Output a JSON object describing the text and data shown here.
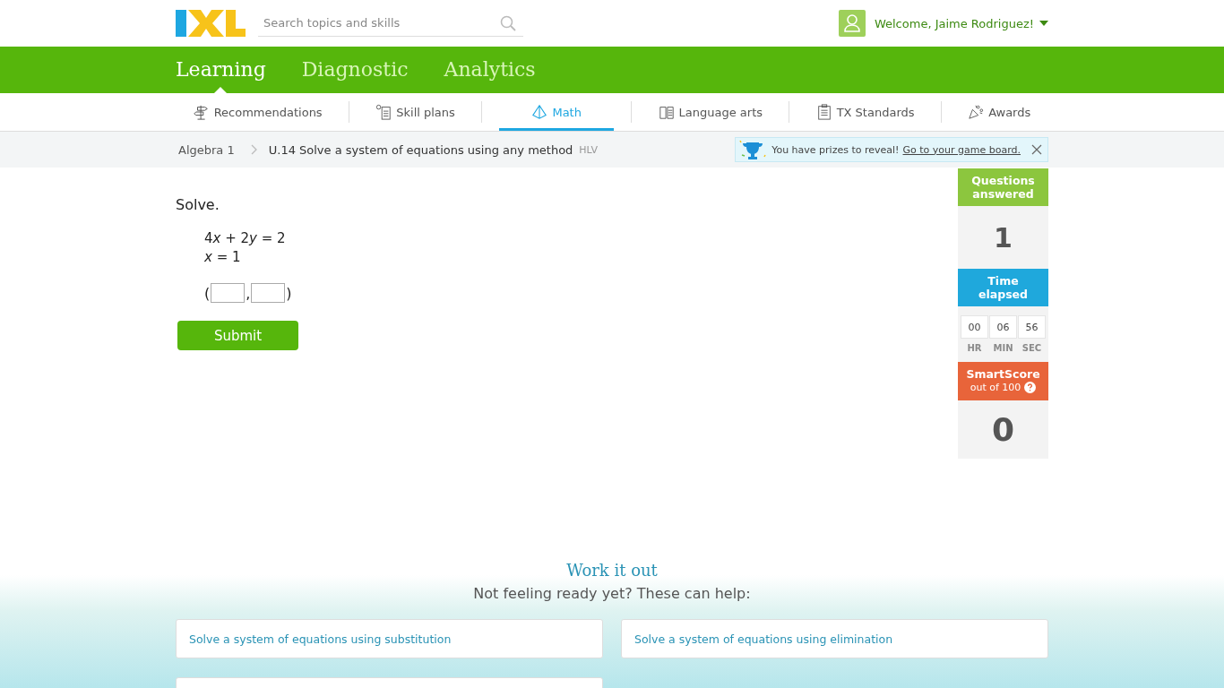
{
  "header": {
    "search": {
      "placeholder": "Search topics and skills"
    },
    "welcome": "Welcome, Jaime Rodriguez!"
  },
  "main_nav": [
    {
      "label": "Learning",
      "selected": true
    },
    {
      "label": "Diagnostic",
      "selected": false
    },
    {
      "label": "Analytics",
      "selected": false
    }
  ],
  "sub_nav": [
    {
      "label": "Recommendations",
      "kind": "recommend",
      "selected": false
    },
    {
      "label": "Skill plans",
      "kind": "plans",
      "selected": false
    },
    {
      "label": "Math",
      "kind": "math",
      "selected": true
    },
    {
      "label": "Language arts",
      "kind": "book",
      "selected": false
    },
    {
      "label": "TX Standards",
      "kind": "standards",
      "selected": false
    },
    {
      "label": "Awards",
      "kind": "awards",
      "selected": false
    }
  ],
  "breadcrumb": {
    "subject": "Algebra 1",
    "skill": "U.14 Solve a system of equations using any method",
    "code": "HLV"
  },
  "prize_notice": {
    "text": "You have prizes to reveal!",
    "link": "Go to your game board."
  },
  "question": {
    "prompt": "Solve.",
    "equations": [
      [
        {
          "t": "4",
          "italic": false
        },
        {
          "t": "x",
          "italic": true
        },
        {
          "t": " + 2",
          "italic": false
        },
        {
          "t": "y",
          "italic": true
        },
        {
          "t": " = 2",
          "italic": false
        }
      ],
      [
        {
          "t": "x",
          "italic": true
        },
        {
          "t": " = 1",
          "italic": false
        }
      ]
    ],
    "answer_marks": {
      "open": "(",
      "separator": ",",
      "close": ")"
    },
    "submit": "Submit"
  },
  "stats": {
    "answered_label": "Questions answered",
    "answered": "1",
    "time_label": "Time elapsed",
    "time": [
      {
        "value": "00",
        "unit": "HR"
      },
      {
        "value": "06",
        "unit": "MIN"
      },
      {
        "value": "56",
        "unit": "SEC"
      }
    ],
    "score_label": "SmartScore",
    "score_sub": "out of 100",
    "score": "0"
  },
  "help": {
    "title": "Work it out",
    "subtitle": "Not feeling ready yet? These can help:",
    "links": [
      "Solve a system of equations using substitution",
      "Solve a system of equations using elimination"
    ]
  }
}
